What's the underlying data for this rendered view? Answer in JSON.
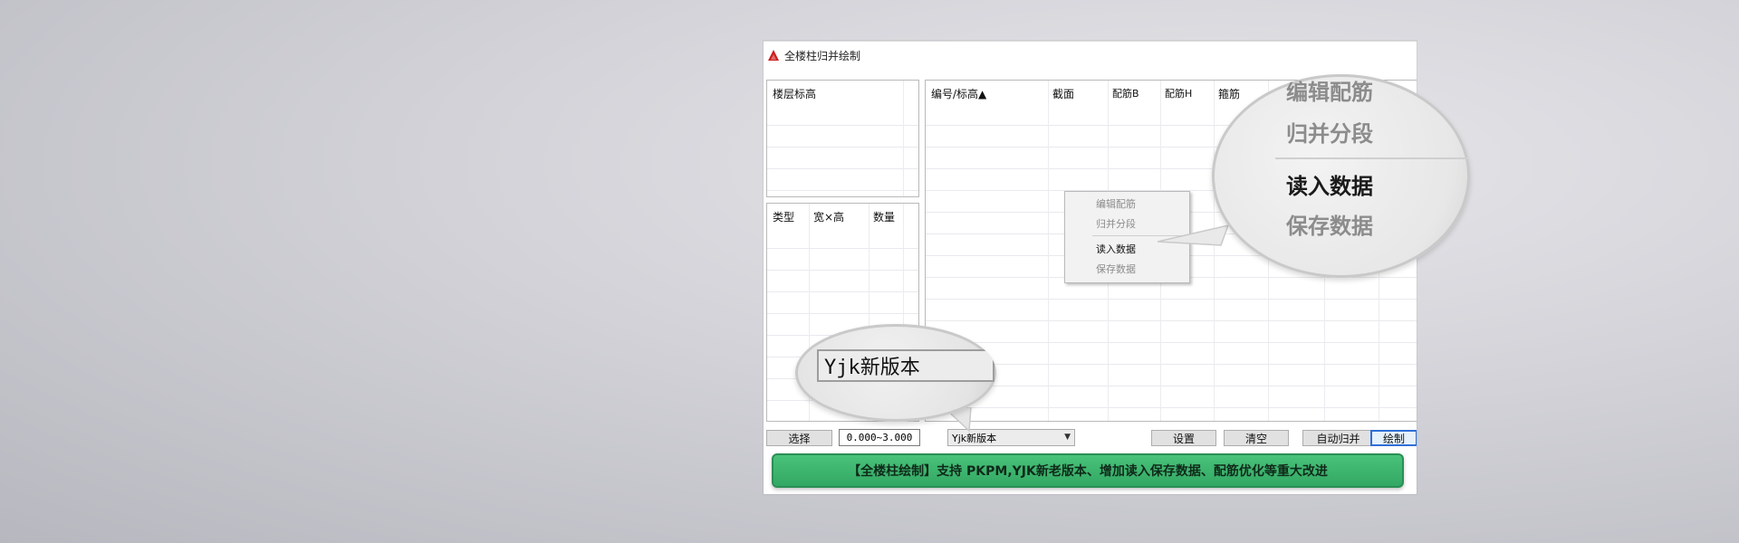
{
  "window": {
    "title": "全楼柱归并绘制",
    "accent_color": "#cc1f1f"
  },
  "floor_panel": {
    "header": "楼层标高"
  },
  "type_panel": {
    "columns": [
      "类型",
      "宽×高",
      "数量"
    ]
  },
  "main_table": {
    "columns": [
      "编号/标高▲",
      "截面",
      "配筋B",
      "配筋H",
      "箍筋"
    ]
  },
  "context_menu": {
    "items": [
      {
        "label": "编辑配筋",
        "enabled": false
      },
      {
        "label": "归并分段",
        "enabled": false
      },
      {
        "label": "读入数据",
        "enabled": true
      },
      {
        "label": "保存数据",
        "enabled": false
      }
    ]
  },
  "magnifier_menu": {
    "items": [
      "编辑配筋",
      "归并分段",
      "读入数据",
      "保存数据"
    ]
  },
  "bottom_bar": {
    "select_button": "选择",
    "range_value": "0.000~3.000",
    "version_select": "Yjk新版本",
    "settings_button": "设置",
    "clear_button": "清空",
    "auto_merge_button": "自动归并",
    "draw_button": "绘制"
  },
  "magnifier_version": {
    "label": "Yjk新版本"
  },
  "banner": {
    "text": "【全楼柱绘制】支持 PKPM,YJK新老版本、增加读入保存数据、配筋优化等重大改进",
    "color": "#3bb56e"
  }
}
